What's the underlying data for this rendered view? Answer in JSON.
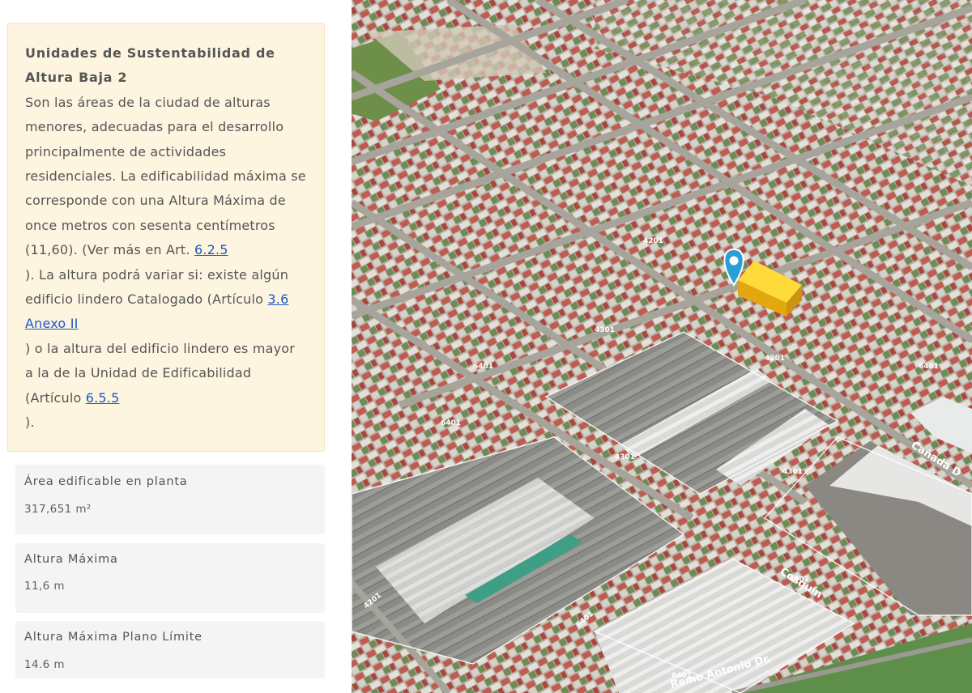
{
  "zone": {
    "title": "Unidades de Sustentabilidad de Altura Baja 2",
    "desc_1": "Son las áreas de la ciudad de alturas menores, adecuadas para el desarrollo principalmente de actividades residenciales. La edificabilidad máxima se corresponde con una Altura Máxima de once metros con sesenta centímetros (11,60). (Ver más en Art. ",
    "link_1": "6.2.5",
    "desc_2": "). La altura podrá variar si: existe algún edificio lindero Catalogado (Artículo ",
    "link_2": "3.6 Anexo II",
    "desc_3": ") o la altura del edificio lindero es mayor a la de la Unidad de Edificabilidad (Artículo ",
    "link_3": "6.5.5",
    "desc_4": ")."
  },
  "stats": [
    {
      "label": "Área edificable en planta",
      "value": "317,651 m²"
    },
    {
      "label": "Altura Máxima",
      "value": "11,6 m"
    },
    {
      "label": "Altura Máxima Plano Límite",
      "value": "14.6 m"
    }
  ],
  "map": {
    "road_labels": [
      "6401",
      "4301",
      "4201",
      "4201",
      "6401",
      "4301",
      "6401",
      "4301",
      "4201",
      "6401",
      "4301",
      "6401"
    ],
    "street_labels": [
      "Cosquín",
      "Cañada D",
      "Remo Antonio Dr."
    ],
    "pin_icon": "location-pin-icon",
    "colors": {
      "highlight_block": "#f3c21d",
      "pin": "#2a9fd6",
      "parcel_outline": "#ffffff"
    }
  }
}
